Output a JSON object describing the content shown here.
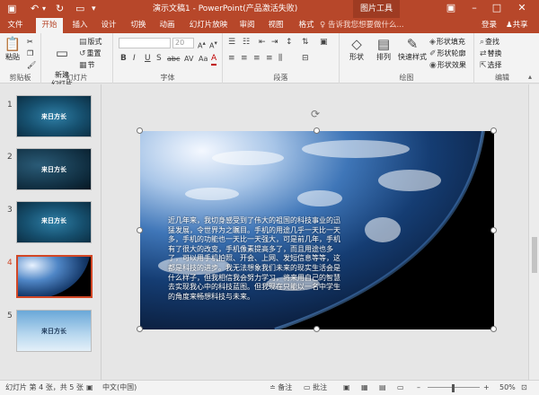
{
  "titlebar": {
    "doc_title": "演示文稿1 - PowerPoint(产品激活失败)",
    "contextual_tool": "图片工具",
    "icons": [
      "save-icon",
      "undo-icon",
      "redo-icon",
      "slideshow-icon",
      "customize-icon",
      "ribbon-options-icon",
      "minimize-icon",
      "maximize-icon",
      "close-icon"
    ]
  },
  "tabs": {
    "items": [
      "文件",
      "开始",
      "插入",
      "设计",
      "切换",
      "动画",
      "幻灯片放映",
      "审阅",
      "视图",
      "格式"
    ],
    "active": "开始",
    "tellme": "告诉我您想要做什么...",
    "login": "登录",
    "share": "共享"
  },
  "ribbon": {
    "clipboard": {
      "paste": "粘贴",
      "label": "剪贴板"
    },
    "slides": {
      "new_slide": "新建\n幻灯片",
      "layout": "版式",
      "reset": "重置",
      "section": "节",
      "label": "幻灯片"
    },
    "font": {
      "font_size": "20",
      "label": "字体",
      "bold": "B",
      "italic": "I",
      "underline": "U",
      "shadow": "S",
      "strike": "abc",
      "spacing": "AV",
      "case": "Aa",
      "color": "A"
    },
    "paragraph": {
      "label": "段落"
    },
    "drawing": {
      "shapes": "形状",
      "arrange": "排列",
      "quick_styles": "快速样式",
      "fill": "形状填充",
      "outline": "形状轮廓",
      "effects": "形状效果",
      "label": "绘图"
    },
    "editing": {
      "find": "查找",
      "replace": "替换",
      "select": "选择",
      "label": "编辑"
    }
  },
  "thumbnails": [
    {
      "num": "1",
      "title": "来日方长"
    },
    {
      "num": "2",
      "title": "来日方长"
    },
    {
      "num": "3",
      "title": "来日方长"
    },
    {
      "num": "4",
      "title": ""
    },
    {
      "num": "5",
      "title": "来日方长"
    }
  ],
  "active_slide": "4",
  "slide": {
    "body_text": "近几年来，我切身感受到了伟大的祖国的科技事业的迅猛发展，令世界为之瞩目。手机的用途几乎一天比一天多，手机的功能也一天比一天强大，可是前几年，手机有了很大的改变，手机像素提高多了，而且用途也多了，可以用手机拍照、开会、上网、发短信息等等，这都是科技的进步。我无法想象我们未来的现实生活会是什么样子，但我相信我会努力学习，将来用自己的智慧去实现我心中的科技蓝图。但我现在只能以一名中学生的角度来畅想科技与未来。"
  },
  "statusbar": {
    "slide_info": "幻灯片 第 4 张，共 5 张",
    "language": "中文(中国)",
    "notes": "备注",
    "comments": "批注",
    "zoom": "50%"
  },
  "colors": {
    "accent": "#b7472a",
    "selected": "#d24726"
  }
}
